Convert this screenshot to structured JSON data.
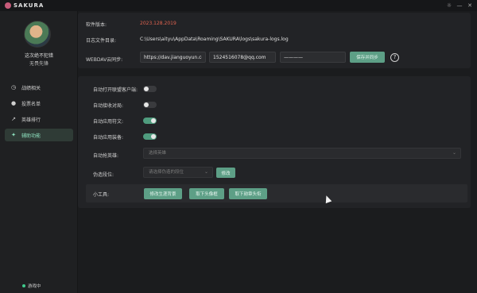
{
  "app": {
    "title": "SAKURA",
    "accent": "#5d9f86"
  },
  "window_controls": {
    "theme": "☼",
    "minimize": "—",
    "close": "✕"
  },
  "user": {
    "name": "这次绝不犯错",
    "title": "无畏先锋"
  },
  "sidebar": {
    "items": [
      {
        "label": "战绩相关",
        "icon": "clock-icon"
      },
      {
        "label": "投票名单",
        "icon": "person-icon"
      },
      {
        "label": "英雄排行",
        "icon": "trend-icon"
      },
      {
        "label": "辅助功能",
        "icon": "tool-icon",
        "active": true
      }
    ],
    "status": "游戏中"
  },
  "info": {
    "version_label": "软件版本:",
    "version_value": "2023.128.2019",
    "version_color": "#e0634f",
    "log_label": "日志文件目录:",
    "log_value": "C:\\Users\\aityu\\AppData\\Roaming\\SAKURA\\logs\\sakura-logs.log",
    "webdav_label": "WEBDAV云同步:",
    "webdav_url": "https://dav.jianguoyun.co",
    "webdav_user": "1524516078@qq.com",
    "webdav_pass": "————",
    "save_sync": "保存并同步",
    "help": "?"
  },
  "settings": {
    "toggles": [
      {
        "label": "自动打开联盟客户端:",
        "on": false
      },
      {
        "label": "自动接收对局:",
        "on": false
      },
      {
        "label": "自动应用符文:",
        "on": true
      },
      {
        "label": "自动应用装备:",
        "on": true
      }
    ],
    "auto_pick_label": "自动抢英雄:",
    "auto_pick_placeholder": "选择英雄",
    "tier_label": "伪造段位:",
    "tier_placeholder": "请选择伪造的段位",
    "tier_button": "修改",
    "tools_label": "小工具:",
    "tools": [
      "修改生涯背景",
      "取下头像框",
      "取下勋章头衔"
    ]
  }
}
